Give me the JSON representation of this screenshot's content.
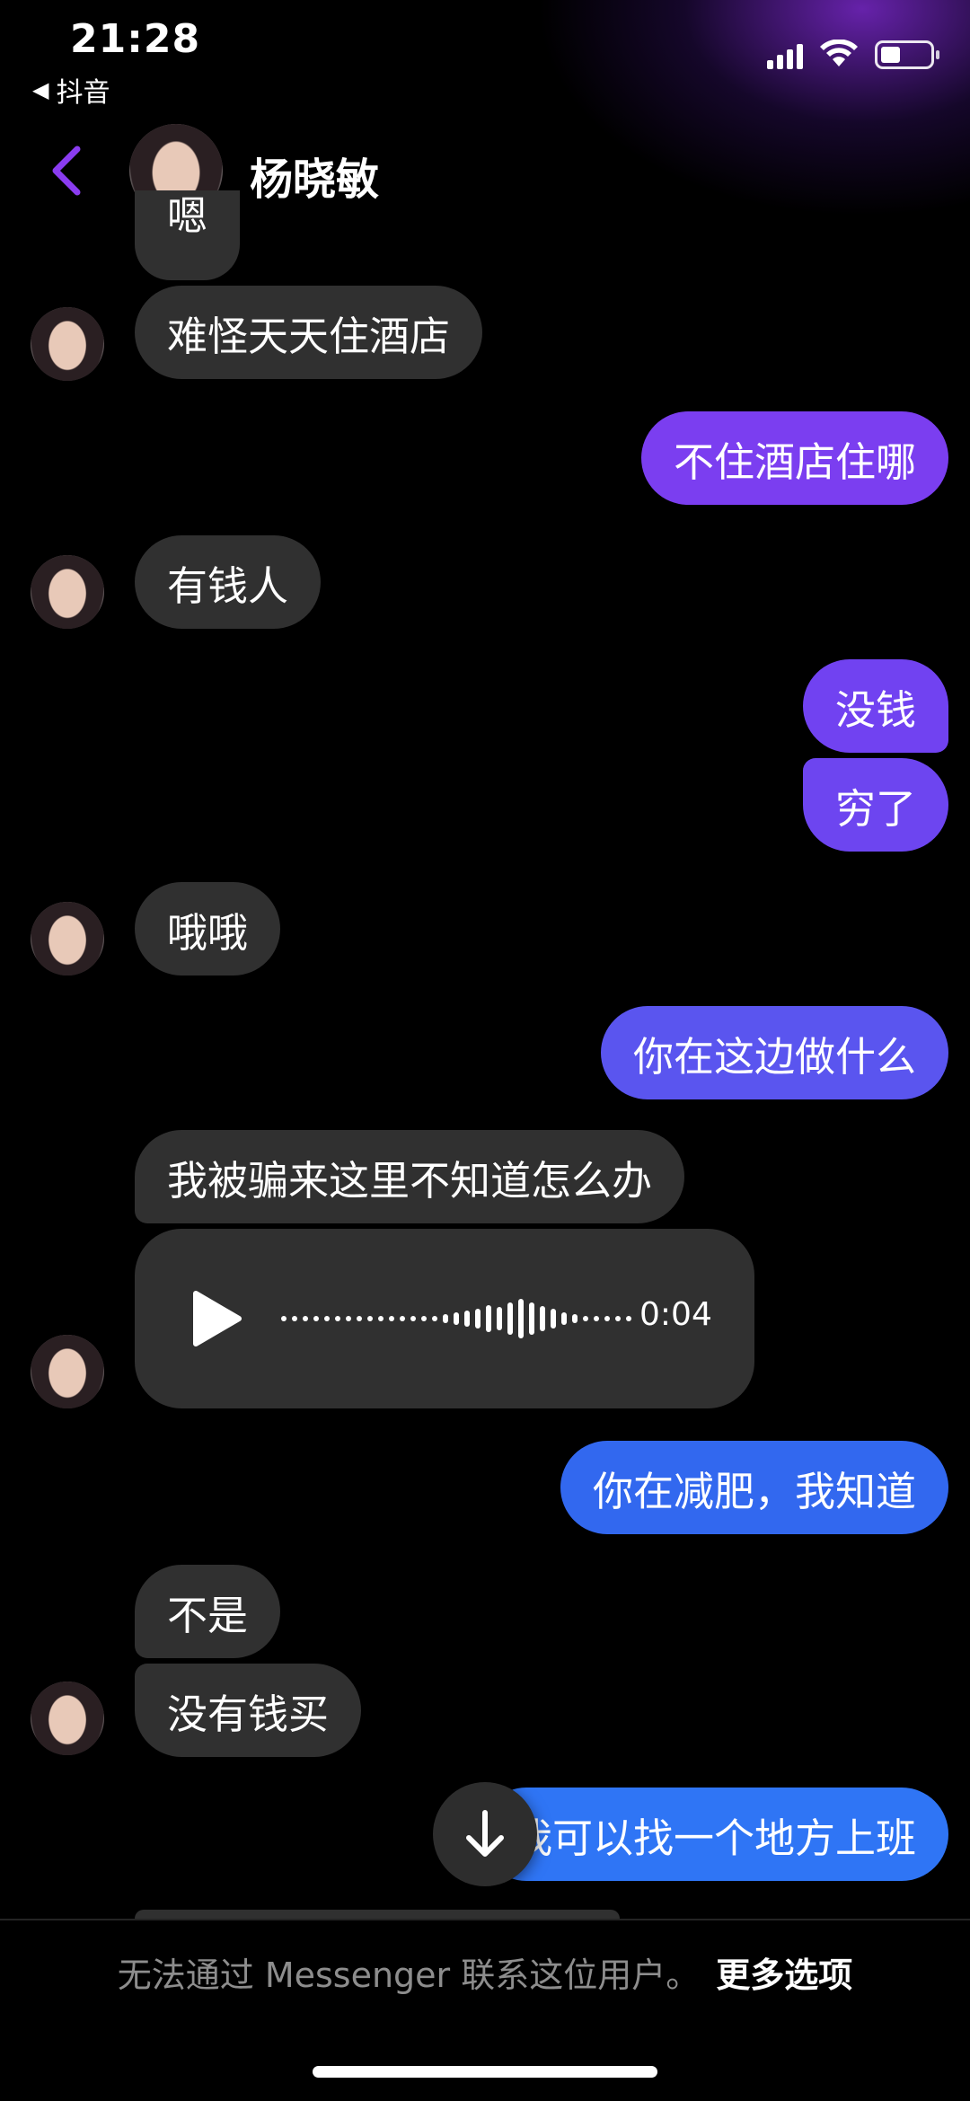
{
  "status_bar": {
    "time": "21:28",
    "back_app": "抖音",
    "icons": [
      "signal-icon",
      "wifi-icon",
      "battery-icon"
    ],
    "battery_level": 0.4
  },
  "header": {
    "contact_name": "杨晓敏",
    "back_icon": "chevron-left-icon"
  },
  "colors": {
    "accent_purple": "#7d3cff",
    "bubble_incoming": "#303030",
    "bubble_out_purple": "#7b3ef0",
    "bubble_out_violet": "#6a50ee",
    "bubble_out_blue": "#3268ef",
    "bubble_out_bright_blue": "#2f75f5"
  },
  "messages": [
    {
      "side": "in",
      "text": "嗯"
    },
    {
      "side": "in",
      "text": "难怪天天住酒店"
    },
    {
      "side": "out",
      "text": "不住酒店住哪"
    },
    {
      "side": "in",
      "text": "有钱人"
    },
    {
      "side": "out",
      "text": "没钱"
    },
    {
      "side": "out",
      "text": "穷了"
    },
    {
      "side": "in",
      "text": "哦哦"
    },
    {
      "side": "out",
      "text": "你在这边做什么"
    },
    {
      "side": "in",
      "text": "我被骗来这里不知道怎么办"
    },
    {
      "side": "out",
      "text": "你在减肥，我知道"
    },
    {
      "side": "in",
      "text": "不是"
    },
    {
      "side": "in",
      "text": "没有钱买"
    },
    {
      "side": "out",
      "text": "我可以找一个地方上班"
    }
  ],
  "voice_message": {
    "duration": "0:04",
    "play_icon": "play-icon"
  },
  "scroll_button": {
    "icon": "arrow-down-icon"
  },
  "footer": {
    "notice": "无法通过 Messenger 联系这位用户。",
    "more_options": "更多选项"
  }
}
